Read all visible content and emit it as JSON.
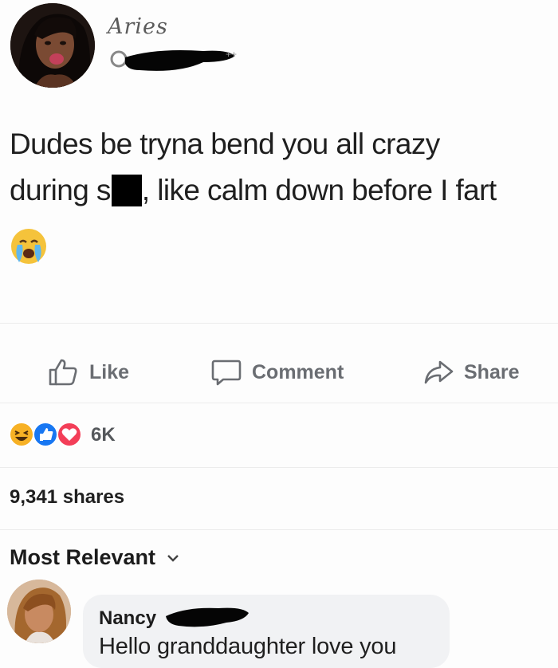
{
  "post": {
    "author_name": "Aries",
    "text_line1": "Dudes be tryna bend you all crazy",
    "text_line2_before": "during s",
    "text_line2_after": ", like calm down before I fart",
    "emoji": "loudly-crying-face"
  },
  "actions": {
    "like_label": "Like",
    "comment_label": "Comment",
    "share_label": "Share"
  },
  "reactions": {
    "icons": [
      "haha-reaction",
      "like-reaction",
      "love-reaction"
    ],
    "count": "6K"
  },
  "shares_text": "9,341 shares",
  "comments_sort": {
    "label": "Most Relevant"
  },
  "comment": {
    "author_name": "Nancy",
    "text": "Hello granddaughter love you"
  },
  "colors": {
    "action_gray": "#6a6d72",
    "like_blue": "#1877f2",
    "love_red": "#f33e58",
    "haha_yellow": "#f7b125"
  }
}
